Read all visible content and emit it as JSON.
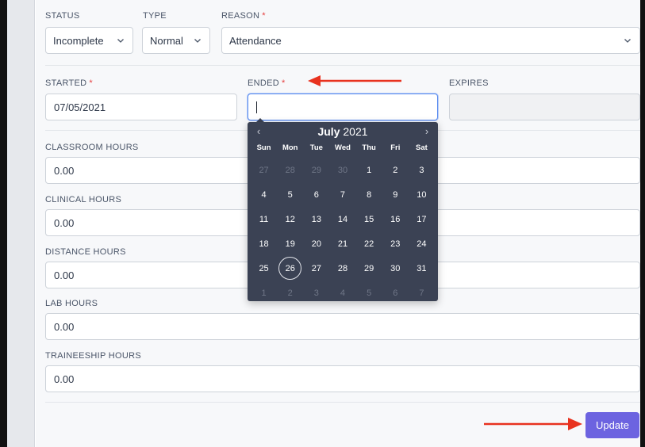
{
  "labels": {
    "status": "STATUS",
    "type": "TYPE",
    "reason": "REASON",
    "started": "STARTED",
    "ended": "ENDED",
    "expires": "EXPIRES",
    "classroom": "CLASSROOM HOURS",
    "clinical": "CLINICAL HOURS",
    "distance": "DISTANCE HOURS",
    "lab": "LAB HOURS",
    "traineeship": "TRAINEESHIP HOURS",
    "required_mark": "*"
  },
  "fields": {
    "status": "Incomplete",
    "type": "Normal",
    "reason": "Attendance",
    "started": "07/05/2021",
    "ended": "",
    "expires": "",
    "classroom": "0.00",
    "clinical": "0.00",
    "distance": "0.00",
    "lab": "0.00",
    "traineeship": "0.00"
  },
  "calendar": {
    "month": "July",
    "year": "2021",
    "prev": "‹",
    "next": "›",
    "weekdays": [
      "Sun",
      "Mon",
      "Tue",
      "Wed",
      "Thu",
      "Fri",
      "Sat"
    ],
    "days": [
      {
        "d": "27",
        "m": true
      },
      {
        "d": "28",
        "m": true
      },
      {
        "d": "29",
        "m": true
      },
      {
        "d": "30",
        "m": true
      },
      {
        "d": "1"
      },
      {
        "d": "2"
      },
      {
        "d": "3"
      },
      {
        "d": "4"
      },
      {
        "d": "5"
      },
      {
        "d": "6"
      },
      {
        "d": "7"
      },
      {
        "d": "8"
      },
      {
        "d": "9"
      },
      {
        "d": "10"
      },
      {
        "d": "11"
      },
      {
        "d": "12"
      },
      {
        "d": "13"
      },
      {
        "d": "14"
      },
      {
        "d": "15"
      },
      {
        "d": "16"
      },
      {
        "d": "17"
      },
      {
        "d": "18"
      },
      {
        "d": "19"
      },
      {
        "d": "20"
      },
      {
        "d": "21"
      },
      {
        "d": "22"
      },
      {
        "d": "23"
      },
      {
        "d": "24"
      },
      {
        "d": "25"
      },
      {
        "d": "26",
        "today": true
      },
      {
        "d": "27"
      },
      {
        "d": "28"
      },
      {
        "d": "29"
      },
      {
        "d": "30"
      },
      {
        "d": "31"
      },
      {
        "d": "1",
        "m": true
      },
      {
        "d": "2",
        "m": true
      },
      {
        "d": "3",
        "m": true
      },
      {
        "d": "4",
        "m": true
      },
      {
        "d": "5",
        "m": true
      },
      {
        "d": "6",
        "m": true
      },
      {
        "d": "7",
        "m": true
      }
    ]
  },
  "buttons": {
    "update": "Update"
  },
  "colors": {
    "accent": "#6c63e0",
    "annotation_arrow": "#e8321f",
    "required": "#e53e3e",
    "calendar_bg": "#3b4254"
  }
}
